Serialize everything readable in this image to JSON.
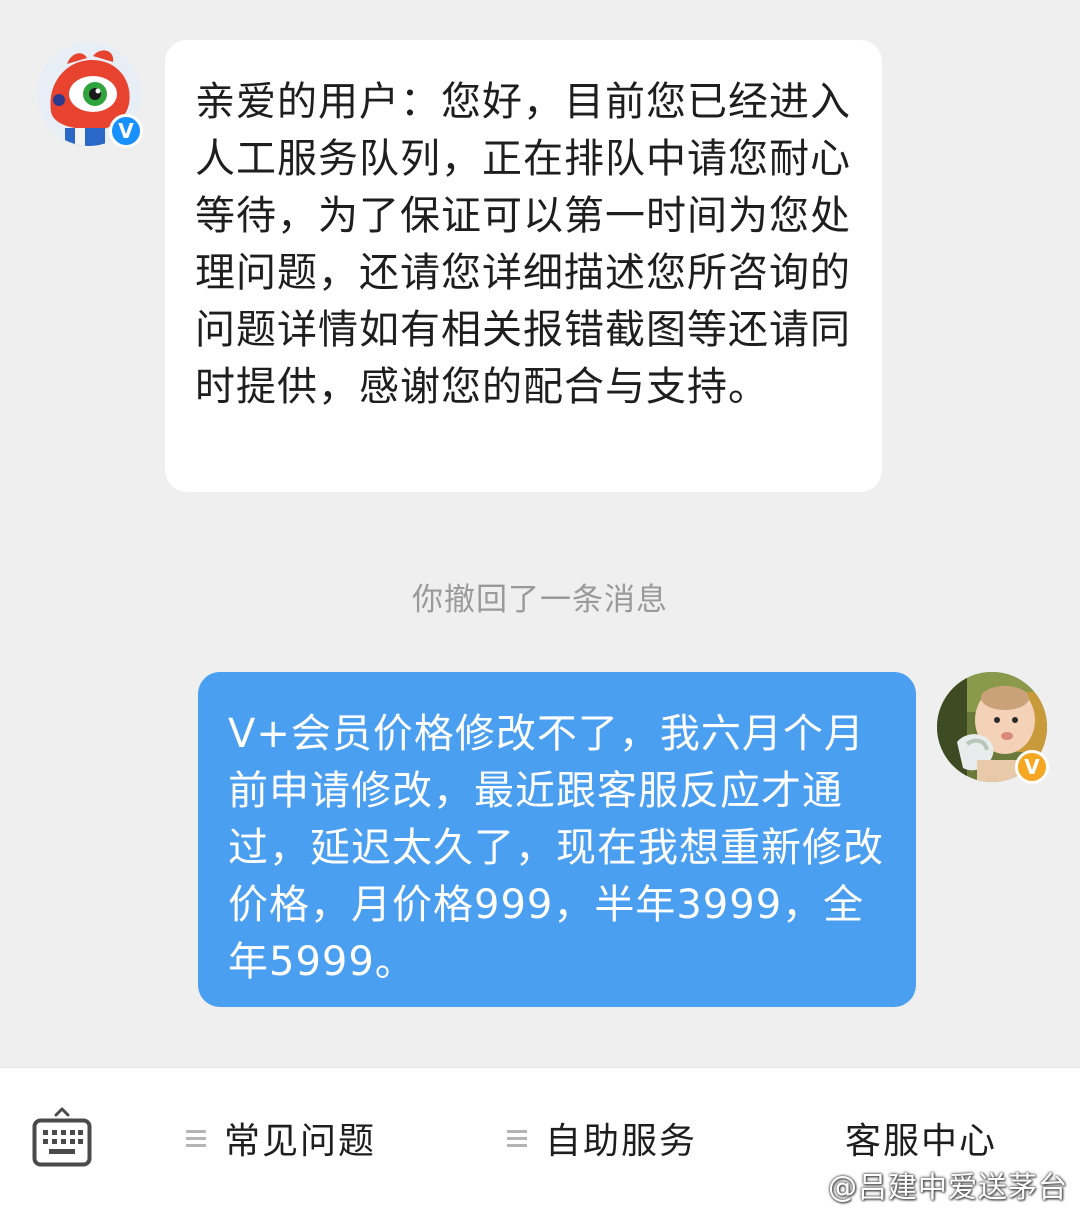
{
  "messages": {
    "incoming": {
      "avatar_icon": "weibo-mascot-avatar",
      "badge_text": "V",
      "badge_color": "#1890ff",
      "text": "亲爱的用户：您好，目前您已经进入人工服务队列，正在排队中请您耐心等待，为了保证可以第一时间为您处理问题，还请您详细描述您所咨询的问题详情如有相关报错截图等还请同时提供，感谢您的配合与支持。"
    },
    "system_notice": "你撤回了一条消息",
    "outgoing": {
      "avatar_icon": "baby-photo-avatar",
      "badge_text": "V",
      "badge_color": "#f5a623",
      "bubble_color": "#4b9ff0",
      "text": "V+会员价格修改不了，我六月个月前申请修改，最近跟客服反应才通过，延迟太久了，现在我想重新修改价格，月价格999，半年3999，全年5999。"
    }
  },
  "bottom_bar": {
    "keyboard_icon": "keyboard-icon",
    "items": [
      {
        "label": "常见问题",
        "icon": "menu-lines-icon"
      },
      {
        "label": "自助服务",
        "icon": "menu-lines-icon"
      },
      {
        "label": "客服中心"
      }
    ]
  },
  "watermark": {
    "icon": "weibo-logo-icon",
    "text": "@吕建中爱送茅台"
  }
}
